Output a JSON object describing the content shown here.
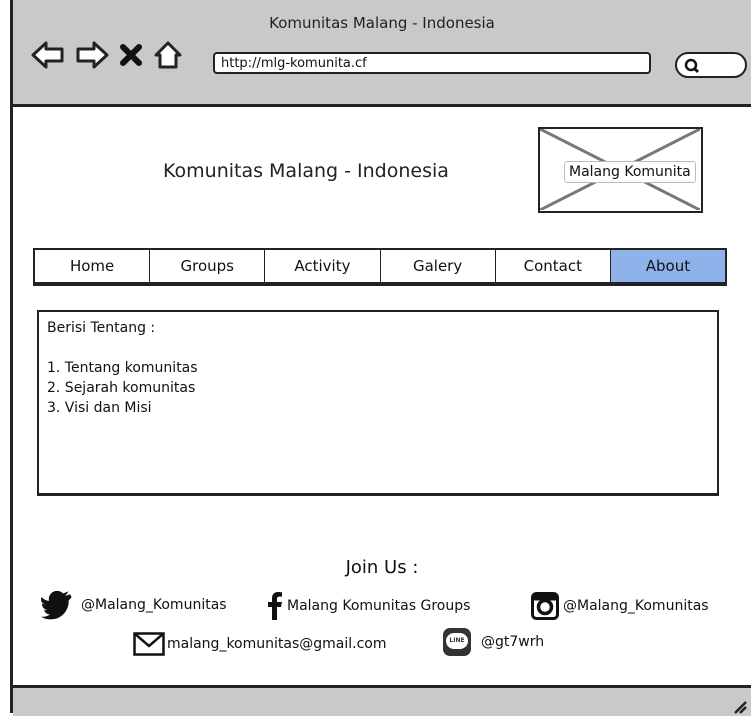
{
  "window": {
    "title": "Komunitas Malang - Indonesia"
  },
  "browser": {
    "url": "http://mlg-komunita.cf",
    "icons": [
      "back-arrow-icon",
      "forward-arrow-icon",
      "stop-icon",
      "home-icon",
      "search-icon"
    ]
  },
  "header": {
    "title": "Komunitas Malang - Indonesia",
    "logo_label": "Malang Komunita"
  },
  "nav": {
    "tabs": [
      {
        "label": "Home",
        "active": false
      },
      {
        "label": "Groups",
        "active": false
      },
      {
        "label": "Activity",
        "active": false
      },
      {
        "label": "Galery",
        "active": false
      },
      {
        "label": "Contact",
        "active": false
      },
      {
        "label": "About",
        "active": true
      }
    ],
    "active_color": "#8fb2ea"
  },
  "content": {
    "heading": "Berisi Tentang :",
    "items": [
      "1. Tentang komunitas",
      "2. Sejarah komunitas",
      "3. Visi dan Misi"
    ]
  },
  "footer": {
    "join_label": "Join Us :",
    "twitter": "@Malang_Komunitas",
    "facebook": "Malang Komunitas Groups",
    "instagram": "@Malang_Komunitas",
    "email": "malang_komunitas@gmail.com",
    "line": "@gt7wrh",
    "line_badge": "LINE"
  }
}
